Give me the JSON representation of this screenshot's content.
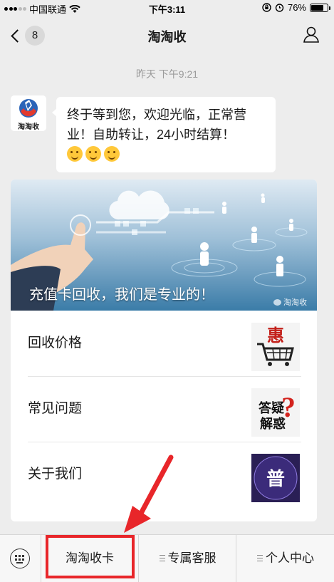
{
  "status_bar": {
    "carrier": "中国联通",
    "time": "下午3:11",
    "battery": "76%",
    "battery_level": 0.76
  },
  "nav": {
    "badge_count": "8",
    "title": "淘淘收"
  },
  "chat": {
    "timestamp": "昨天 下午9:21",
    "avatar_label": "淘淘收",
    "message": "终于等到您，欢迎光临，正常营业！自助转让，24小时结算！"
  },
  "card": {
    "banner_caption": "充值卡回收，我们是专业的！",
    "banner_brand": "淘淘收",
    "items": [
      {
        "label": "回收价格",
        "thumb_icon": "cart-sale-icon",
        "thumb_text": "惠"
      },
      {
        "label": "常见问题",
        "thumb_icon": "question-icon",
        "thumb_text": "答疑解惑"
      },
      {
        "label": "关于我们",
        "thumb_icon": "about-icon",
        "thumb_text": "普"
      }
    ]
  },
  "bottom_menu": {
    "items": [
      {
        "label": "淘淘收卡"
      },
      {
        "label": "专属客服"
      },
      {
        "label": "个人中心"
      }
    ]
  },
  "colors": {
    "background": "#ededed",
    "annotation_red": "#e8262a"
  }
}
